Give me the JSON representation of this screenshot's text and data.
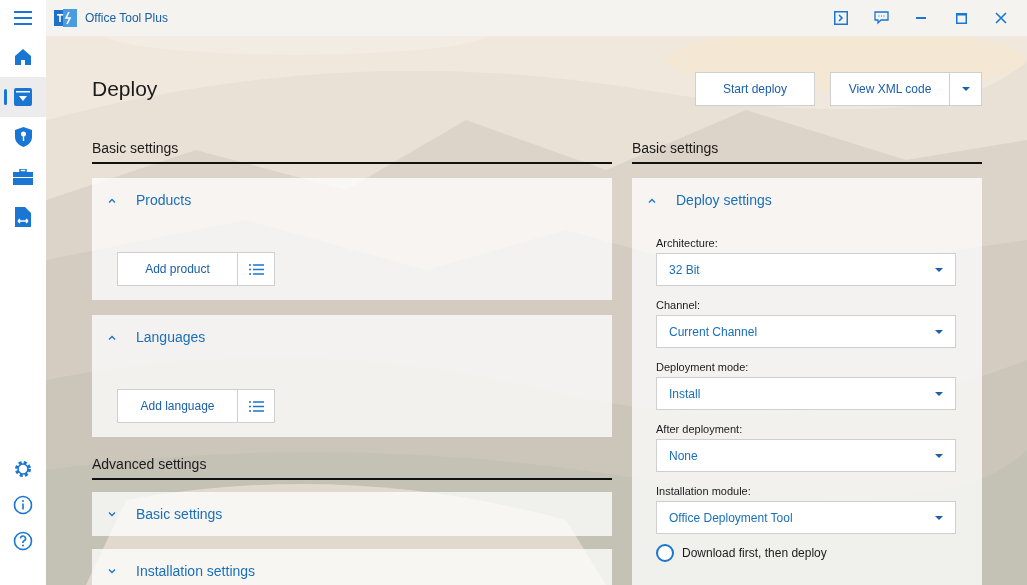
{
  "title_bar": {
    "title": "Office Tool Plus"
  },
  "sidebar": {
    "items": [
      {
        "kind": "home",
        "selected": false
      },
      {
        "kind": "deploy",
        "selected": true
      },
      {
        "kind": "activate",
        "selected": false
      },
      {
        "kind": "toolbox",
        "selected": false
      },
      {
        "kind": "convert",
        "selected": false
      }
    ],
    "bottom_items": [
      {
        "kind": "settings",
        "selected": false
      },
      {
        "kind": "about",
        "selected": false
      },
      {
        "kind": "help",
        "selected": false
      }
    ]
  },
  "page": {
    "title": "Deploy",
    "actions": [
      "Start deploy",
      "View XML code"
    ]
  },
  "left": {
    "heading": "Basic settings",
    "sections": [
      {
        "title": "Products",
        "expanded": true,
        "button": "Add product"
      },
      {
        "title": "Languages",
        "expanded": true,
        "button": "Add language"
      }
    ],
    "advanced_heading": "Advanced settings",
    "advanced_sections": [
      {
        "title": "Basic settings",
        "expanded": false
      },
      {
        "title": "Installation settings",
        "expanded": false
      }
    ]
  },
  "right": {
    "heading": "Basic settings",
    "section": {
      "title": "Deploy settings",
      "expanded": true
    },
    "fields": [
      {
        "label": "Architecture:",
        "value": "32 Bit"
      },
      {
        "label": "Channel:",
        "value": "Current Channel"
      },
      {
        "label": "Deployment mode:",
        "value": "Install"
      },
      {
        "label": "After deployment:",
        "value": "None"
      },
      {
        "label": "Installation module:",
        "value": "Office Deployment Tool"
      }
    ],
    "option": {
      "label": "Download first, then deploy",
      "checked": false
    }
  }
}
